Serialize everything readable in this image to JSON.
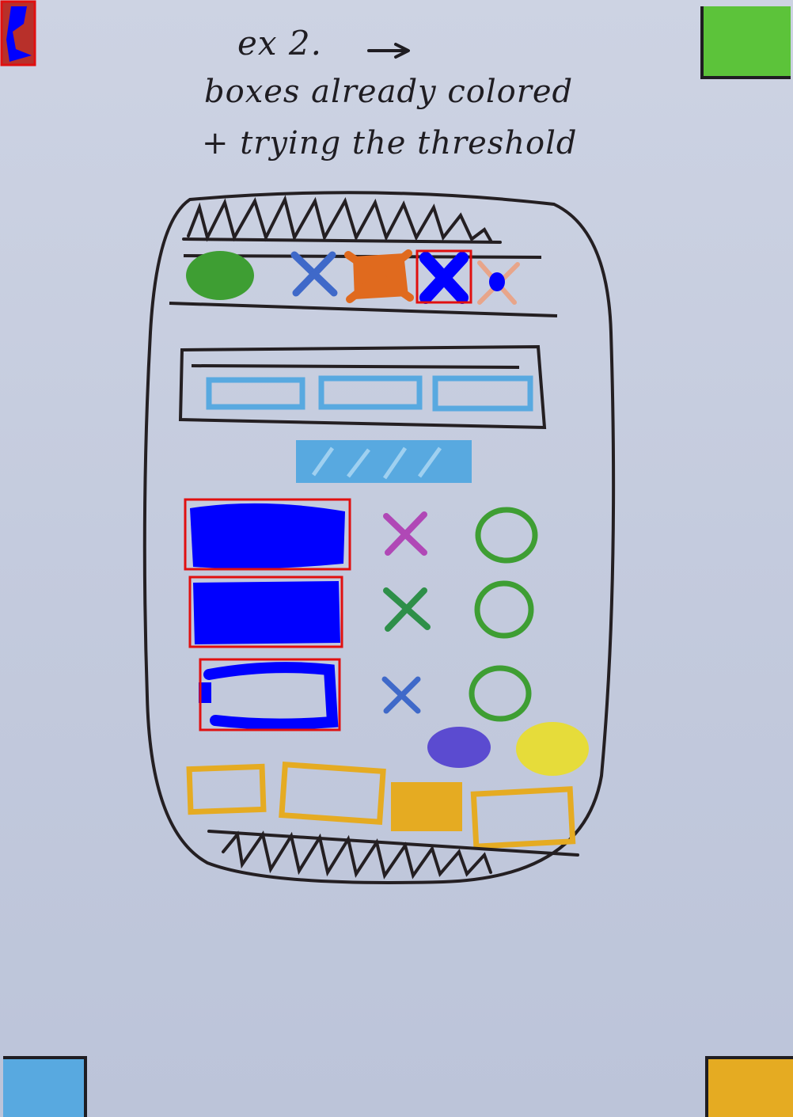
{
  "notes": {
    "line1": "ex 2.",
    "line2": "boxes already colored",
    "line3": "+ trying the threshold"
  },
  "colors": {
    "paper": "#c9cfe0",
    "ink": "#1f1d22",
    "detection_box": "#e01010",
    "detection_fill": "#0000ff",
    "marker_green": "#3e9e33",
    "marker_orange": "#e06a1e",
    "marker_peach": "#e8a58a",
    "marker_light_blue": "#58a9e0",
    "marker_magenta": "#b048b6",
    "marker_dark_green": "#2e8f49",
    "marker_mid_blue": "#3f69c9",
    "marker_purple": "#5b4bd0",
    "marker_yellow": "#e6dc3a",
    "marker_amber": "#e5ab22"
  },
  "sketch": {
    "detections": [
      "corner-marker-top-left",
      "toolbar-item-4",
      "list-row-1",
      "list-row-2",
      "list-row-3"
    ],
    "list_rows": [
      {
        "x_mark": "magenta",
        "circle": "green"
      },
      {
        "x_mark": "green",
        "circle": "green"
      },
      {
        "x_mark": "blue",
        "circle": "green"
      }
    ],
    "toolbar_items": [
      "green-dot",
      "blue-x",
      "orange-scribble",
      "blue-x-detected",
      "peach-x"
    ],
    "tabs_count": 3,
    "bottom_boxes_count": 4
  }
}
